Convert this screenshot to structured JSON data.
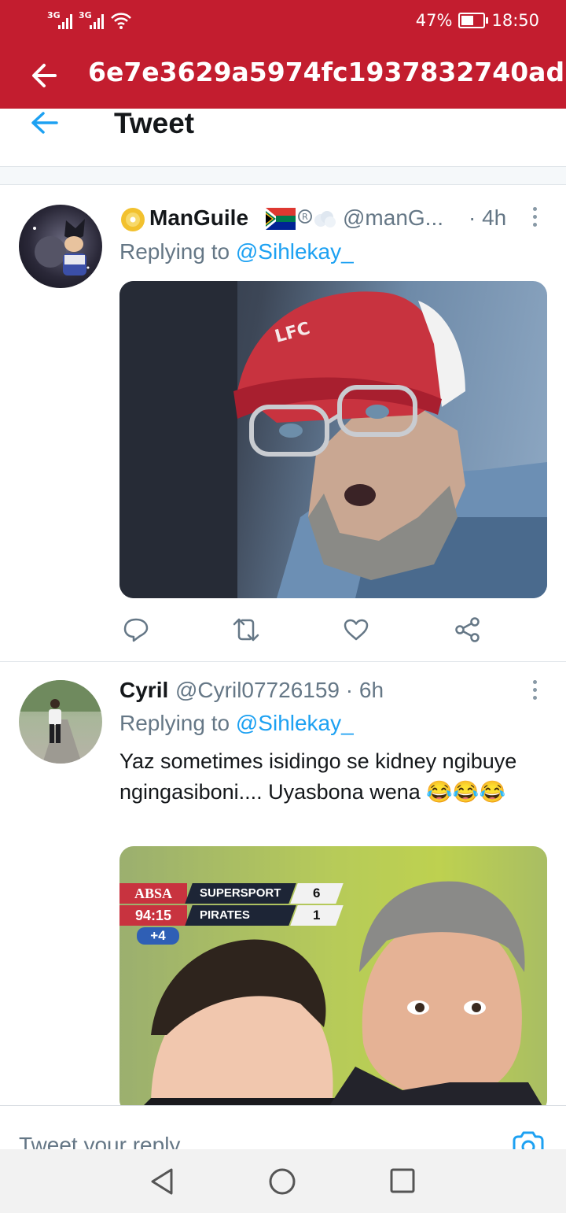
{
  "status_bar": {
    "sig1": "3G",
    "sig2": "3G",
    "battery": "47%",
    "battery_level": 0.47,
    "time": "18:50"
  },
  "app_bar": {
    "title": "6e7e3629a5974fc1937832740ad..."
  },
  "tweet_header": {
    "title": "Tweet"
  },
  "tweets": [
    {
      "name": "ManGuile",
      "handle": "@manG...",
      "time": "· 4h",
      "replying_label": "Replying to",
      "replying_handle": "@Sihlekay_"
    },
    {
      "name": "Cyril",
      "handle": "@Cyril07726159 · 6h",
      "replying_label": "Replying to",
      "replying_handle": "@Sihlekay_",
      "text": "Yaz sometimes isidingo se kidney ngibuye ngingasiboni.... Uyasbona wena 😂😂😂",
      "scoreboard": {
        "sponsor": "ABSA",
        "team1": "SUPERSPORT",
        "score1": "6",
        "clock": "94:15",
        "team2": "PIRATES",
        "score2": "1",
        "added": "+4"
      },
      "cap_logo": "LFC"
    }
  ],
  "reply_bar": {
    "placeholder": "Tweet your reply"
  },
  "colors": {
    "header": "#c31d2f",
    "link": "#1da1f2",
    "muted": "#657786"
  },
  "icons": [
    "back-arrow-icon",
    "reply-icon",
    "retweet-icon",
    "like-icon",
    "share-icon",
    "camera-icon",
    "nav-back-icon",
    "nav-home-icon",
    "nav-recents-icon"
  ]
}
